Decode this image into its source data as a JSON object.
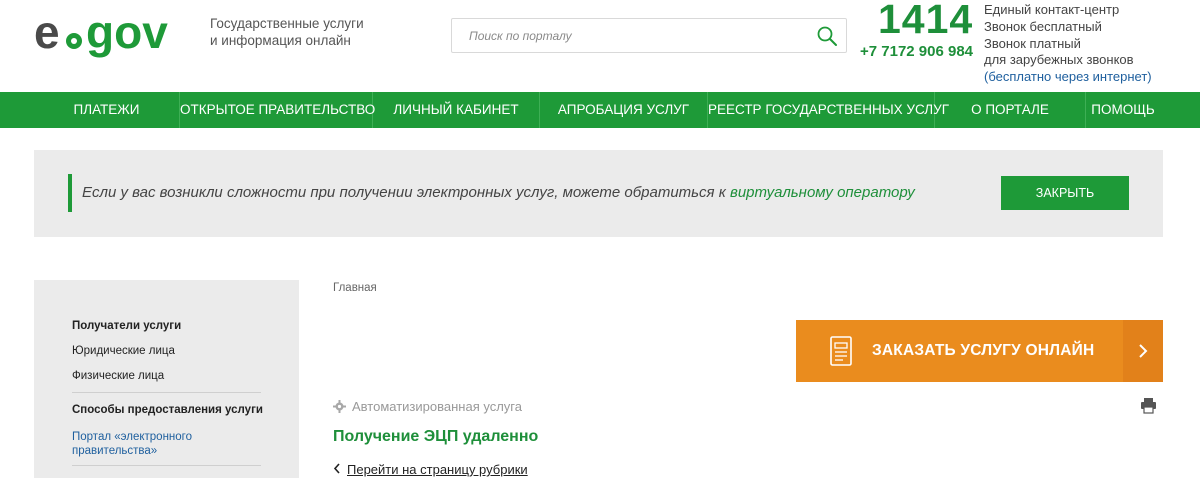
{
  "header": {
    "logo_text": "egov",
    "tagline_line1": "Государственные услуги",
    "tagline_line2": "и информация онлайн",
    "search_placeholder": "Поиск по порталу",
    "phone_short": "1414",
    "phone_long": "+7 7172 906 984",
    "contact_line1": "Единый контакт-центр",
    "contact_line2": "Звонок бесплатный",
    "contact_line3": "Звонок платный",
    "contact_line4": "для зарубежных звонков",
    "contact_line5": "(бесплатно через интернет)"
  },
  "nav": {
    "items": [
      {
        "label": "ПЛАТЕЖИ"
      },
      {
        "label": "ОТКРЫТОЕ ПРАВИТЕЛЬСТВО"
      },
      {
        "label": "ЛИЧНЫЙ КАБИНЕТ"
      },
      {
        "label": "АПРОБАЦИЯ УСЛУГ"
      },
      {
        "label": "РЕЕСТР ГОСУДАРСТВЕННЫХ УСЛУГ"
      },
      {
        "label": "О ПОРТАЛЕ"
      },
      {
        "label": "ПОМОЩЬ"
      }
    ]
  },
  "notice": {
    "text": "Если у вас возникли сложности при получении электронных услуг, можете обратиться к ",
    "link": "виртуальному оператору",
    "close_label": "ЗАКРЫТЬ"
  },
  "sidebar": {
    "recipients_heading": "Получатели услуги",
    "recipient_items": [
      "Юридические лица",
      "Физические лица"
    ],
    "methods_heading": "Способы предоставления услуги",
    "method_link_line1": "Портал «электронного",
    "method_link_line2": "правительства»"
  },
  "main": {
    "breadcrumb": "Главная",
    "order_button": "ЗАКАЗАТЬ УСЛУГУ ОНЛАЙН",
    "service_type": "Автоматизированная услуга",
    "service_title": "Получение ЭЦП удаленно",
    "back_link": "Перейти на страницу рубрики"
  },
  "colors": {
    "brand_green": "#1e9a38",
    "text_green": "#1e8f3a",
    "order_orange": "#ea8c1e",
    "link_blue": "#1e5f9e"
  }
}
